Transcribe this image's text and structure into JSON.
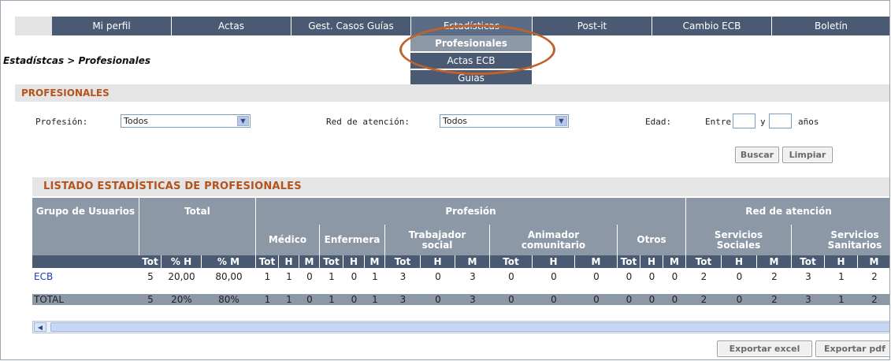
{
  "nav": {
    "items": [
      "Mi perfil",
      "Actas",
      "Gest. Casos Guías",
      "Estadísticas",
      "Post-it",
      "Cambio ECB",
      "Boletín"
    ],
    "dropdown": [
      "Profesionales",
      "Actas ECB",
      "Guías"
    ]
  },
  "breadcrumb": "Estadístcas > Profesionales",
  "section_title": "PROFESIONALES",
  "filters": {
    "profesion_label": "Profesión:",
    "profesion_value": "Todos",
    "red_label": "Red de atención:",
    "red_value": "Todos",
    "edad_label": "Edad:",
    "entre": "Entre",
    "y": "y",
    "anos": "años",
    "buscar": "Buscar",
    "limpiar": "Limpiar"
  },
  "list_title": "LISTADO ESTADÍSTICAS DE PROFESIONALES",
  "table": {
    "h1": {
      "grupo": "Grupo de Usuarios",
      "total": "Total",
      "profesion": "Profesión",
      "red": "Red de atención"
    },
    "h2": {
      "medico": "Médico",
      "enfermera": "Enfermera",
      "trabajador": "Trabajador social",
      "animador": "Animador comunitario",
      "otros": "Otros",
      "serv_sociales": "Servicios Sociales",
      "serv_sanitarios": "Servicios Sanitarios"
    },
    "h3": [
      "Tot",
      "% H",
      "% M",
      "Tot",
      "H",
      "M",
      "Tot",
      "H",
      "M",
      "Tot",
      "H",
      "M",
      "Tot",
      "H",
      "M",
      "Tot",
      "H",
      "M",
      "Tot",
      "H",
      "M",
      "Tot",
      "H",
      "M"
    ],
    "rows": [
      {
        "label": "ECB",
        "values": [
          "5",
          "20,00",
          "80,00",
          "1",
          "1",
          "0",
          "1",
          "0",
          "1",
          "3",
          "0",
          "3",
          "0",
          "0",
          "0",
          "0",
          "0",
          "0",
          "2",
          "0",
          "2",
          "3",
          "1",
          "2"
        ]
      },
      {
        "label": "TOTAL",
        "values": [
          "5",
          "20%",
          "80%",
          "1",
          "1",
          "0",
          "1",
          "0",
          "1",
          "3",
          "0",
          "3",
          "0",
          "0",
          "0",
          "0",
          "0",
          "0",
          "2",
          "0",
          "2",
          "3",
          "1",
          "2"
        ]
      }
    ]
  },
  "buttons": {
    "export_excel": "Exportar excel",
    "export_pdf": "Exportar pdf"
  },
  "colors": {
    "nav_bg": "#4a5a72",
    "accent": "#b5531f",
    "header_bg": "#8d98a7",
    "highlight_ellipse": "#c0622a"
  }
}
